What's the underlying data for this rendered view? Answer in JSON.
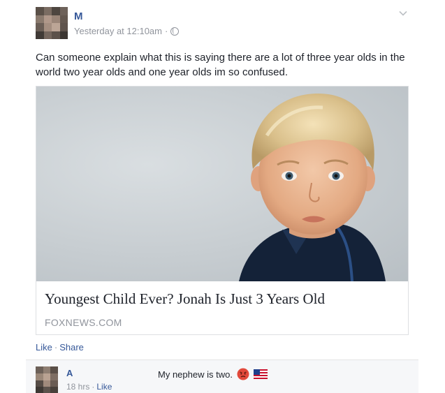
{
  "post": {
    "author": "M",
    "timestamp": "Yesterday at 12:10am",
    "separator": "·",
    "privacy_icon": "globe-icon",
    "menu_icon": "chevron-down-icon",
    "text": "Can someone explain what this is saying there are a lot of three year olds in the world two year olds and one year olds im so confused."
  },
  "link": {
    "title": "Youngest Child Ever? Jonah Is Just 3 Years Old",
    "source": "FOXNEWS.COM",
    "image_icon": "photo-of-boy"
  },
  "actions": {
    "like": "Like",
    "separator": "·",
    "share": "Share"
  },
  "comment": {
    "author": "A",
    "time": "18 hrs",
    "separator": "·",
    "like": "Like",
    "text": "My nephew is two.",
    "emoji_1": "angry-face-icon",
    "emoji_2": "us-flag-icon"
  },
  "colors": {
    "link_blue": "#365899",
    "meta_gray": "#90949c",
    "text": "#1d2129",
    "border": "#dddfe2",
    "comment_bg": "#f6f7f9"
  }
}
